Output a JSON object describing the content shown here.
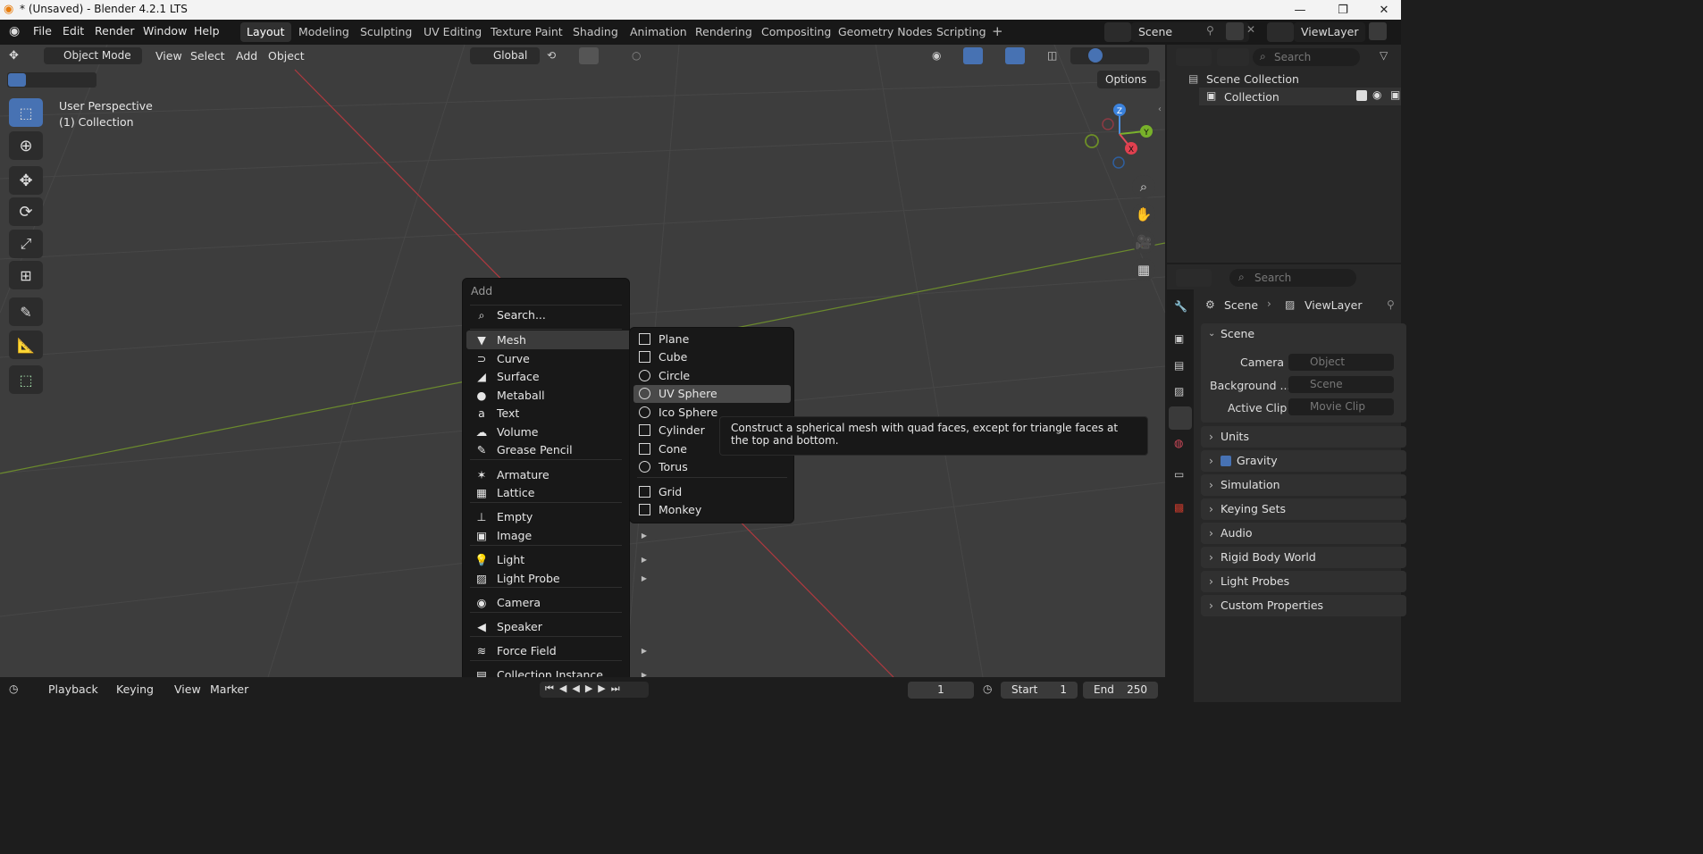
{
  "window": {
    "title": "* (Unsaved) - Blender 4.2.1 LTS"
  },
  "menubar": [
    "File",
    "Edit",
    "Render",
    "Window",
    "Help"
  ],
  "workspaces": [
    {
      "label": "Layout",
      "active": true
    },
    {
      "label": "Modeling",
      "active": false
    },
    {
      "label": "Sculpting",
      "active": false
    },
    {
      "label": "UV Editing",
      "active": false
    },
    {
      "label": "Texture Paint",
      "active": false
    },
    {
      "label": "Shading",
      "active": false
    },
    {
      "label": "Animation",
      "active": false
    },
    {
      "label": "Rendering",
      "active": false
    },
    {
      "label": "Compositing",
      "active": false
    },
    {
      "label": "Geometry Nodes",
      "active": false
    },
    {
      "label": "Scripting",
      "active": false
    }
  ],
  "scene_selector": {
    "scene": "Scene",
    "view_layer": "ViewLayer"
  },
  "viewport_header": {
    "mode": "Object Mode",
    "menus": [
      "View",
      "Select",
      "Add",
      "Object"
    ],
    "orientation": "Global",
    "options": "Options"
  },
  "viewport": {
    "perspective": "User Perspective",
    "collection": "(1) Collection",
    "gizmo": {
      "x": "X",
      "y": "Y",
      "z": "Z"
    }
  },
  "add_menu": {
    "title": "Add",
    "search": "Search...",
    "items": [
      {
        "label": "Mesh",
        "icon": "▼",
        "submenu": true,
        "highlight": true
      },
      {
        "label": "Curve",
        "icon": "⊃",
        "submenu": true
      },
      {
        "label": "Surface",
        "icon": "◢",
        "submenu": true
      },
      {
        "label": "Metaball",
        "icon": "●",
        "submenu": true
      },
      {
        "label": "Text",
        "icon": "a",
        "submenu": false
      },
      {
        "label": "Volume",
        "icon": "☁",
        "submenu": true
      },
      {
        "label": "Grease Pencil",
        "icon": "✎",
        "submenu": true
      },
      {
        "label": "Armature",
        "icon": "✶",
        "submenu": false
      },
      {
        "label": "Lattice",
        "icon": "▦",
        "submenu": false
      },
      {
        "label": "Empty",
        "icon": "⊥",
        "submenu": true
      },
      {
        "label": "Image",
        "icon": "▣",
        "submenu": true
      },
      {
        "label": "Light",
        "icon": "💡",
        "submenu": true
      },
      {
        "label": "Light Probe",
        "icon": "▨",
        "submenu": true
      },
      {
        "label": "Camera",
        "icon": "◉",
        "submenu": false
      },
      {
        "label": "Speaker",
        "icon": "◀",
        "submenu": false
      },
      {
        "label": "Force Field",
        "icon": "≋",
        "submenu": true
      },
      {
        "label": "Collection Instance",
        "icon": "▤",
        "submenu": true
      }
    ]
  },
  "mesh_menu": {
    "items": [
      {
        "label": "Plane"
      },
      {
        "label": "Cube"
      },
      {
        "label": "Circle"
      },
      {
        "label": "UV Sphere",
        "highlight": true
      },
      {
        "label": "Ico Sphere"
      },
      {
        "label": "Cylinder"
      },
      {
        "label": "Cone"
      },
      {
        "label": "Torus"
      },
      {
        "label": "Grid"
      },
      {
        "label": "Monkey"
      }
    ]
  },
  "tooltip": "Construct a spherical mesh with quad faces, except for triangle faces at the top and bottom.",
  "outliner": {
    "search_placeholder": "Search",
    "root": "Scene Collection",
    "child": "Collection"
  },
  "properties": {
    "search_placeholder": "Search",
    "breadcrumb": [
      "Scene",
      "ViewLayer"
    ],
    "scene_panel": "Scene",
    "fields": [
      {
        "label": "Camera",
        "placeholder": "Object"
      },
      {
        "label": "Background ...",
        "placeholder": "Scene"
      },
      {
        "label": "Active Clip",
        "placeholder": "Movie Clip"
      }
    ],
    "panels": [
      "Units",
      "Gravity",
      "Simulation",
      "Keying Sets",
      "Audio",
      "Rigid Body World",
      "Light Probes",
      "Custom Properties"
    ]
  },
  "timeline": {
    "menus": [
      "Playback",
      "Keying",
      "View",
      "Marker"
    ],
    "current_frame": "1",
    "start_label": "Start",
    "start": "1",
    "end_label": "End",
    "end": "250"
  }
}
